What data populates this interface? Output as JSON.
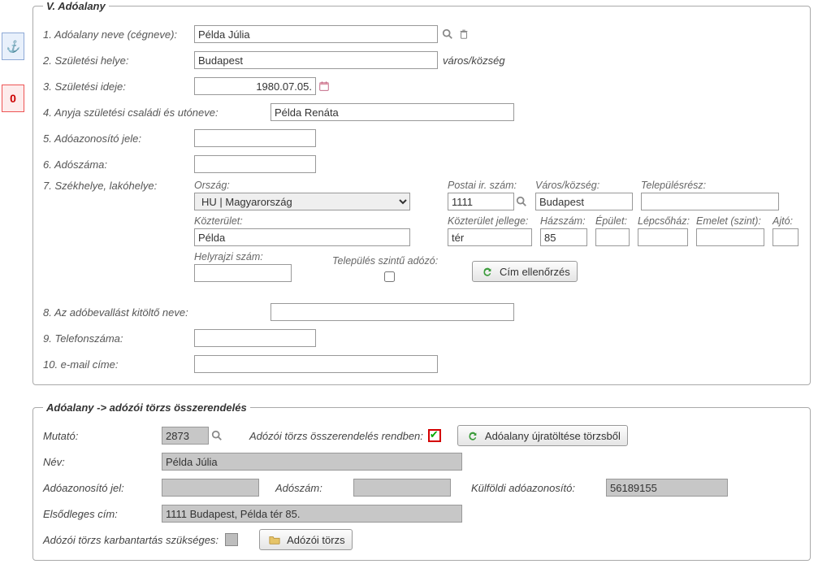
{
  "sidebar": {
    "anchor": "⚓",
    "error_count": "0"
  },
  "section1": {
    "legend": "V. Adóalany",
    "rows": {
      "r1": {
        "label": "1. Adóalany neve (cégneve):",
        "value": "Példa Júlia"
      },
      "r2": {
        "label": "2. Születési helye:",
        "value": "Budapest",
        "suffix": "város/község"
      },
      "r3": {
        "label": "3. Születési ideje:",
        "value": "1980.07.05."
      },
      "r4": {
        "label": "4. Anyja születési családi és utóneve:",
        "value": "Példa Renáta"
      },
      "r5": {
        "label": "5. Adóazonosító jele:",
        "value": ""
      },
      "r6": {
        "label": "6. Adószáma:",
        "value": ""
      },
      "r7": {
        "label": "7. Székhelye, lakóhelye:"
      },
      "r8": {
        "label": "8. Az adóbevallást kitöltő neve:",
        "value": ""
      },
      "r9": {
        "label": "9. Telefonszáma:",
        "value": ""
      },
      "r10": {
        "label": "10. e-mail címe:",
        "value": ""
      }
    },
    "addr": {
      "country_label": "Ország:",
      "country_value": "HU | Magyarország",
      "zip_label": "Postai ir. szám:",
      "zip_value": "1111",
      "city_label": "Város/község:",
      "city_value": "Budapest",
      "district_label": "Településrész:",
      "district_value": "",
      "street_label": "Közterület:",
      "street_value": "Példa",
      "street_type_label": "Közterület jellege:",
      "street_type_value": "tér",
      "house_label": "Házszám:",
      "house_value": "85",
      "building_label": "Épület:",
      "building_value": "",
      "stair_label": "Lépcsőház:",
      "stair_value": "",
      "floor_label": "Emelet (szint):",
      "floor_value": "",
      "door_label": "Ajtó:",
      "door_value": "",
      "lot_label": "Helyrajzi szám:",
      "lot_value": "",
      "muni_label": "Település szintű adózó:",
      "check_btn": "Cím ellenőrzés"
    }
  },
  "section2": {
    "legend": "Adóalany -> adózói törzs összerendelés",
    "mutato_label": "Mutató:",
    "mutato_value": "2873",
    "link_ok_label": "Adózói törzs összerendelés rendben:",
    "reload_btn": "Adóalany újratöltése törzsből",
    "name_label": "Név:",
    "name_value": "Példa Júlia",
    "taxid_label": "Adóazonosító jel:",
    "taxid_value": "",
    "taxnum_label": "Adószám:",
    "taxnum_value": "",
    "foreign_label": "Külföldi adóazonosító:",
    "foreign_value": "56189155",
    "addr_label": "Elsődleges cím:",
    "addr_value": "1111 Budapest, Példa tér 85.",
    "maint_label": "Adózói törzs karbantartás szükséges:",
    "open_btn": "Adózói törzs"
  }
}
